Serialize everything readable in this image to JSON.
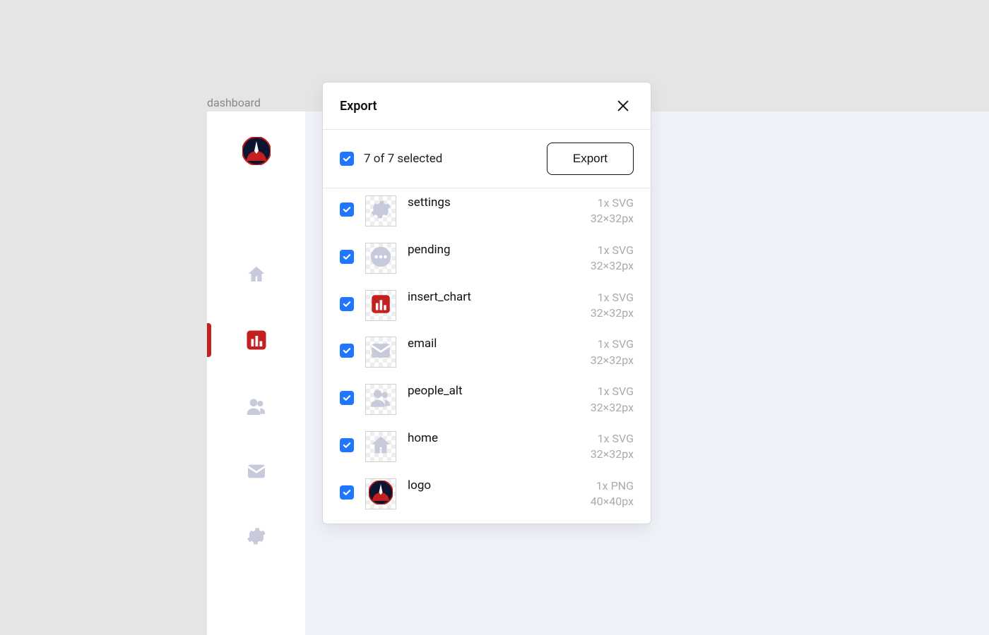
{
  "page_label": "dashboard",
  "sidebar": {
    "items": [
      {
        "name": "home",
        "active": false
      },
      {
        "name": "insert_chart",
        "active": true
      },
      {
        "name": "people_alt",
        "active": false
      },
      {
        "name": "email",
        "active": false
      },
      {
        "name": "settings",
        "active": false
      }
    ]
  },
  "modal": {
    "title": "Export",
    "select_count": "7 of 7 selected",
    "export_label": "Export",
    "assets": [
      {
        "name": "settings",
        "format": "1x SVG",
        "dims": "32×32px",
        "checked": true,
        "icon": "settings"
      },
      {
        "name": "pending",
        "format": "1x SVG",
        "dims": "32×32px",
        "checked": true,
        "icon": "pending"
      },
      {
        "name": "insert_chart",
        "format": "1x SVG",
        "dims": "32×32px",
        "checked": true,
        "icon": "insert_chart"
      },
      {
        "name": "email",
        "format": "1x SVG",
        "dims": "32×32px",
        "checked": true,
        "icon": "email"
      },
      {
        "name": "people_alt",
        "format": "1x SVG",
        "dims": "32×32px",
        "checked": true,
        "icon": "people_alt"
      },
      {
        "name": "home",
        "format": "1x SVG",
        "dims": "32×32px",
        "checked": true,
        "icon": "home"
      },
      {
        "name": "logo",
        "format": "1x PNG",
        "dims": "40×40px",
        "checked": true,
        "icon": "logo"
      }
    ]
  },
  "colors": {
    "accent": "#c42020",
    "check": "#2176ff",
    "muted": "#c6cada"
  }
}
